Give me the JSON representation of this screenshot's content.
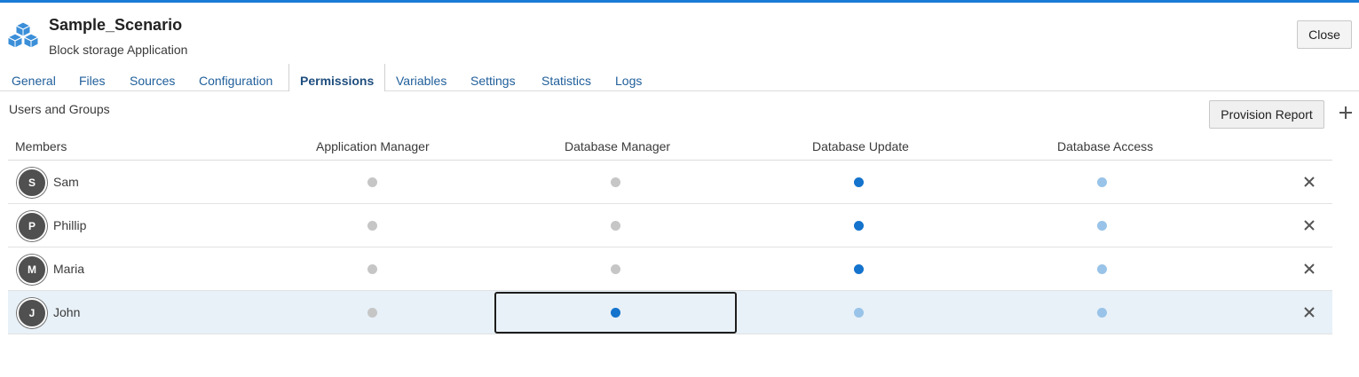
{
  "header": {
    "title": "Sample_Scenario",
    "subtitle": "Block storage Application",
    "close_label": "Close",
    "icon": "cubes-icon"
  },
  "tabs": [
    {
      "label": "General"
    },
    {
      "label": "Files"
    },
    {
      "label": "Sources"
    },
    {
      "label": "Configuration"
    },
    {
      "label": "Permissions",
      "active": true
    },
    {
      "label": "Variables"
    },
    {
      "label": "Settings"
    },
    {
      "label": "Statistics"
    },
    {
      "label": "Logs"
    }
  ],
  "section": {
    "title": "Users and Groups",
    "provision_label": "Provision Report",
    "add_icon": "plus-icon"
  },
  "grid": {
    "columns": [
      "Members",
      "Application Manager",
      "Database Manager",
      "Database Update",
      "Database Access"
    ],
    "rows": [
      {
        "initial": "S",
        "name": "Sam",
        "perms": [
          "off",
          "off",
          "selected",
          "implied"
        ]
      },
      {
        "initial": "P",
        "name": "Phillip",
        "perms": [
          "off",
          "off",
          "selected",
          "implied"
        ]
      },
      {
        "initial": "M",
        "name": "Maria",
        "perms": [
          "off",
          "off",
          "selected",
          "implied"
        ]
      },
      {
        "initial": "J",
        "name": "John",
        "perms": [
          "off",
          "selected",
          "implied",
          "implied"
        ],
        "selected": true
      }
    ]
  },
  "colors": {
    "accent": "#1a7bd6",
    "selected_dot": "#1473cc",
    "implied_dot": "#99c3e8",
    "off_dot": "#c6c6c6",
    "selected_row": "#e8f1f8"
  }
}
